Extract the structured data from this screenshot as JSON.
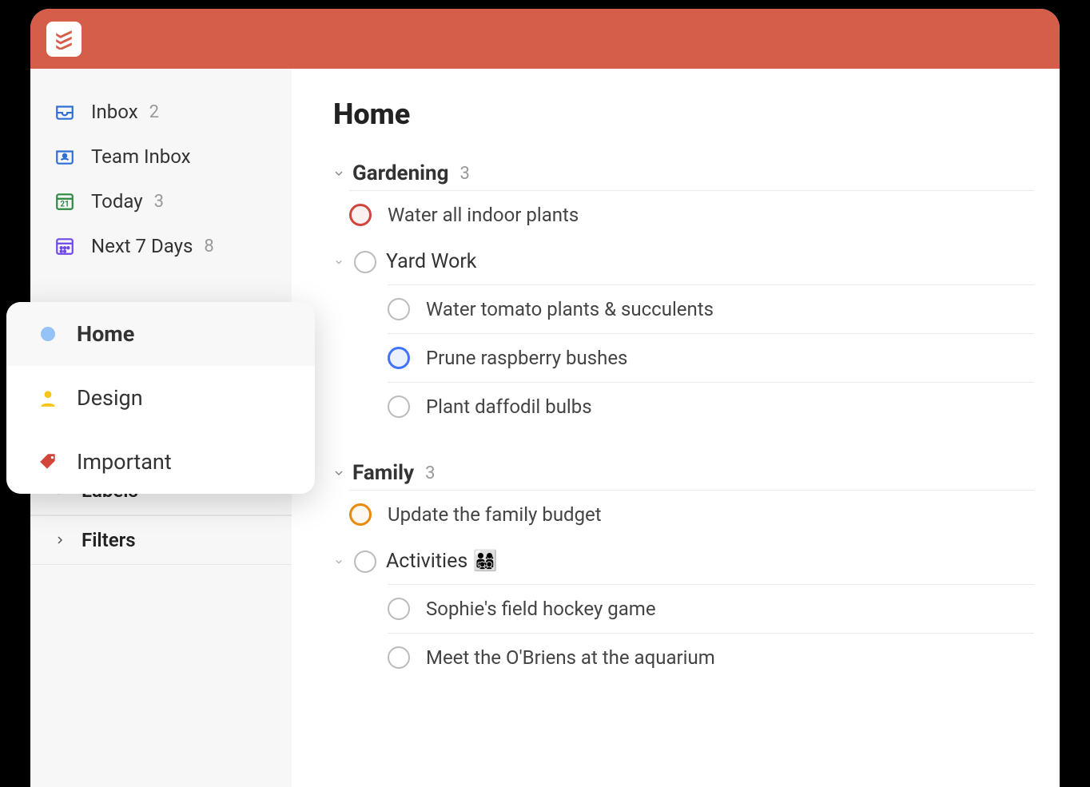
{
  "sidebar": {
    "items": [
      {
        "label": "Inbox",
        "count": "2"
      },
      {
        "label": "Team Inbox",
        "count": ""
      },
      {
        "label": "Today",
        "count": "3"
      },
      {
        "label": "Next 7 Days",
        "count": "8"
      }
    ],
    "sections": [
      {
        "label": "Labels"
      },
      {
        "label": "Filters"
      }
    ]
  },
  "favorites": {
    "items": [
      {
        "label": "Home"
      },
      {
        "label": "Design"
      },
      {
        "label": "Important"
      }
    ]
  },
  "main": {
    "title": "Home",
    "sections": [
      {
        "name": "Gardening",
        "count": "3",
        "tasks": [
          {
            "title": "Water all indoor plants",
            "priority": "red"
          }
        ],
        "parent_tasks": [
          {
            "title": "Yard Work",
            "subtasks": [
              {
                "title": "Water tomato plants & succulents",
                "priority": ""
              },
              {
                "title": "Prune raspberry bushes",
                "priority": "blue"
              },
              {
                "title": "Plant daffodil bulbs",
                "priority": ""
              }
            ]
          }
        ]
      },
      {
        "name": "Family",
        "count": "3",
        "tasks": [
          {
            "title": "Update the family budget",
            "priority": "yellow"
          }
        ],
        "parent_tasks": [
          {
            "title": "Activities 👨‍👩‍👧‍👦",
            "subtasks": [
              {
                "title": "Sophie's field hockey game",
                "priority": ""
              },
              {
                "title": "Meet the O'Briens at the aquarium",
                "priority": ""
              }
            ]
          }
        ]
      }
    ]
  }
}
